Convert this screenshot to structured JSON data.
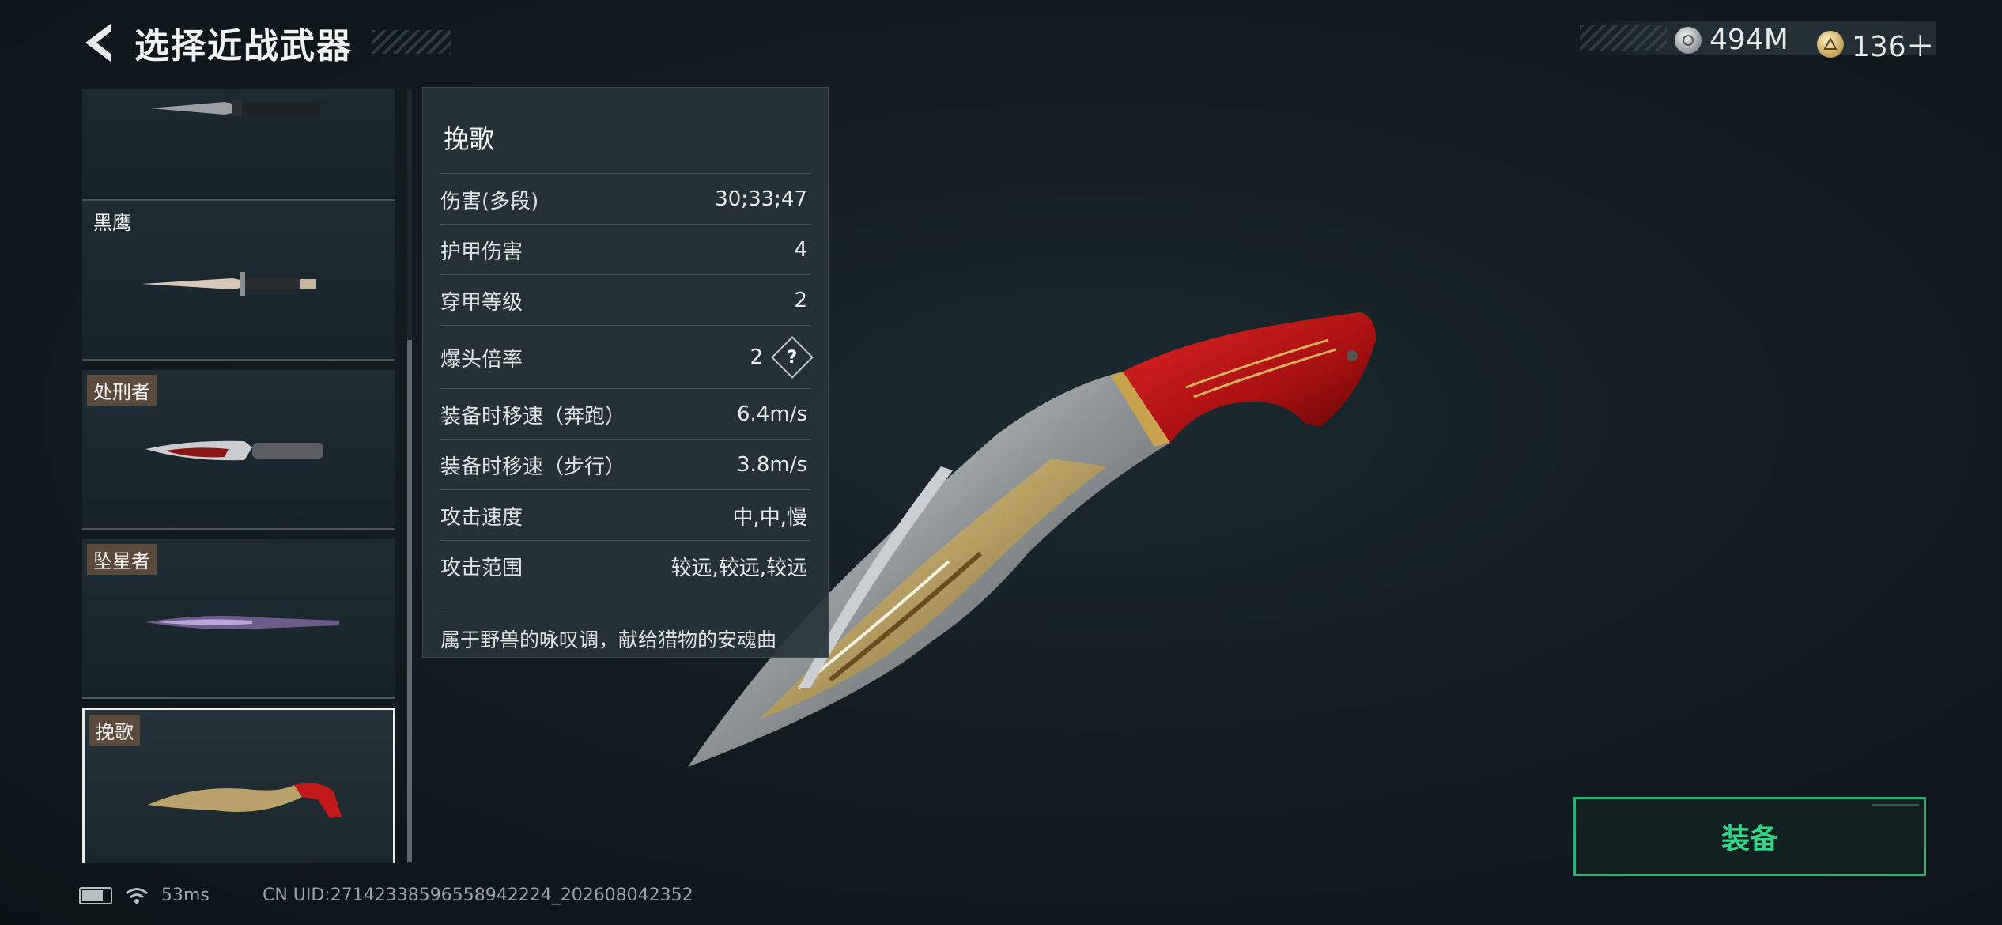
{
  "header": {
    "title": "选择近战武器",
    "currency": [
      {
        "icon": "silver-coin-icon",
        "value": "494M"
      },
      {
        "icon": "gold-token-icon",
        "value": "136＋"
      }
    ]
  },
  "weapon_list": [
    {
      "name": "",
      "badge": false
    },
    {
      "name": "黑鹰",
      "badge": false
    },
    {
      "name": "处刑者",
      "badge": true
    },
    {
      "name": "坠星者",
      "badge": true
    },
    {
      "name": "挽歌",
      "badge": true,
      "selected": true
    }
  ],
  "stats": {
    "name": "挽歌",
    "rows": [
      {
        "label": "伤害(多段)",
        "value": "30;33;47"
      },
      {
        "label": "护甲伤害",
        "value": "4"
      },
      {
        "label": "穿甲等级",
        "value": "2"
      },
      {
        "label": "爆头倍率",
        "value": "2",
        "help": "?"
      },
      {
        "label": "装备时移速（奔跑）",
        "value": "6.4m/s"
      },
      {
        "label": "装备时移速（步行）",
        "value": "3.8m/s"
      },
      {
        "label": "攻击速度",
        "value": "中,中,慢"
      },
      {
        "label": "攻击范围",
        "value": "较远,较远,较远"
      }
    ],
    "description": "属于野兽的咏叹调，献给猎物的安魂曲"
  },
  "equip_button": {
    "label": "装备"
  },
  "footer": {
    "ping": "53ms",
    "uid": "CN UID:27142338596558942224_202608042352"
  },
  "colors": {
    "accent_green": "#35d487",
    "badge_bg": "#5b4a3a",
    "knife_red": "#c21a1a"
  }
}
